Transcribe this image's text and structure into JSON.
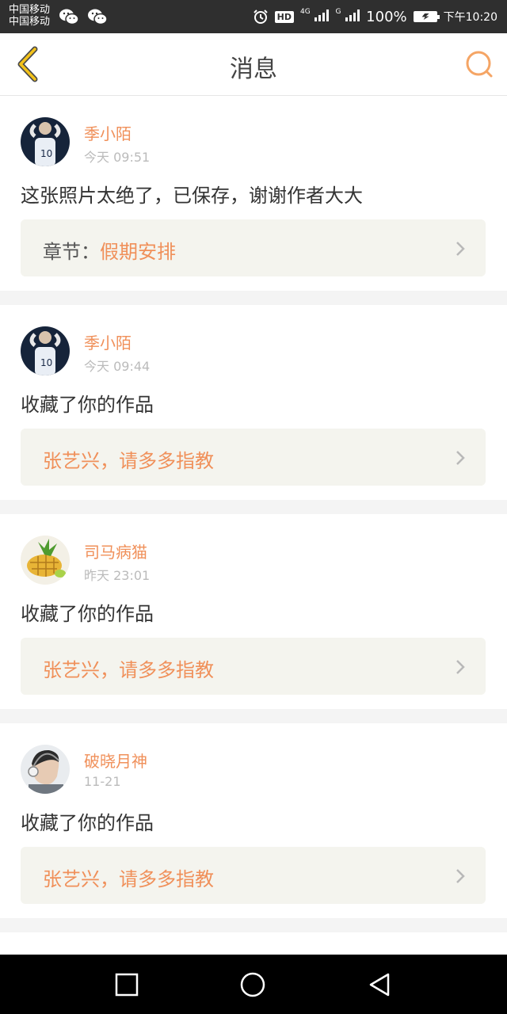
{
  "status_bar": {
    "carrier_1": "中国移动",
    "carrier_2": "中国移动",
    "net_1": "4G",
    "net_2": "G",
    "hd": "HD",
    "battery": "100%",
    "time": "下午10:20"
  },
  "header": {
    "title": "消息",
    "accent_color": "#f0905a"
  },
  "messages": [
    {
      "name": "季小陌",
      "time": "今天 09:51",
      "content": "这张照片太绝了，已保存，谢谢作者大大",
      "ref_prefix": "章节：",
      "ref_link": "假期安排"
    },
    {
      "name": "季小陌",
      "time": "今天 09:44",
      "content": "收藏了你的作品",
      "ref_prefix": "",
      "ref_link": "张艺兴，请多多指教"
    },
    {
      "name": "司马病猫",
      "time": "昨天 23:01",
      "content": "收藏了你的作品",
      "ref_prefix": "",
      "ref_link": "张艺兴，请多多指教"
    },
    {
      "name": "破晓月神",
      "time": "11-21",
      "content": "收藏了你的作品",
      "ref_prefix": "",
      "ref_link": "张艺兴，请多多指教"
    }
  ],
  "nav_bar": {
    "recent_icon": "square-icon",
    "home_icon": "circle-icon",
    "back_icon": "triangle-back-icon"
  }
}
